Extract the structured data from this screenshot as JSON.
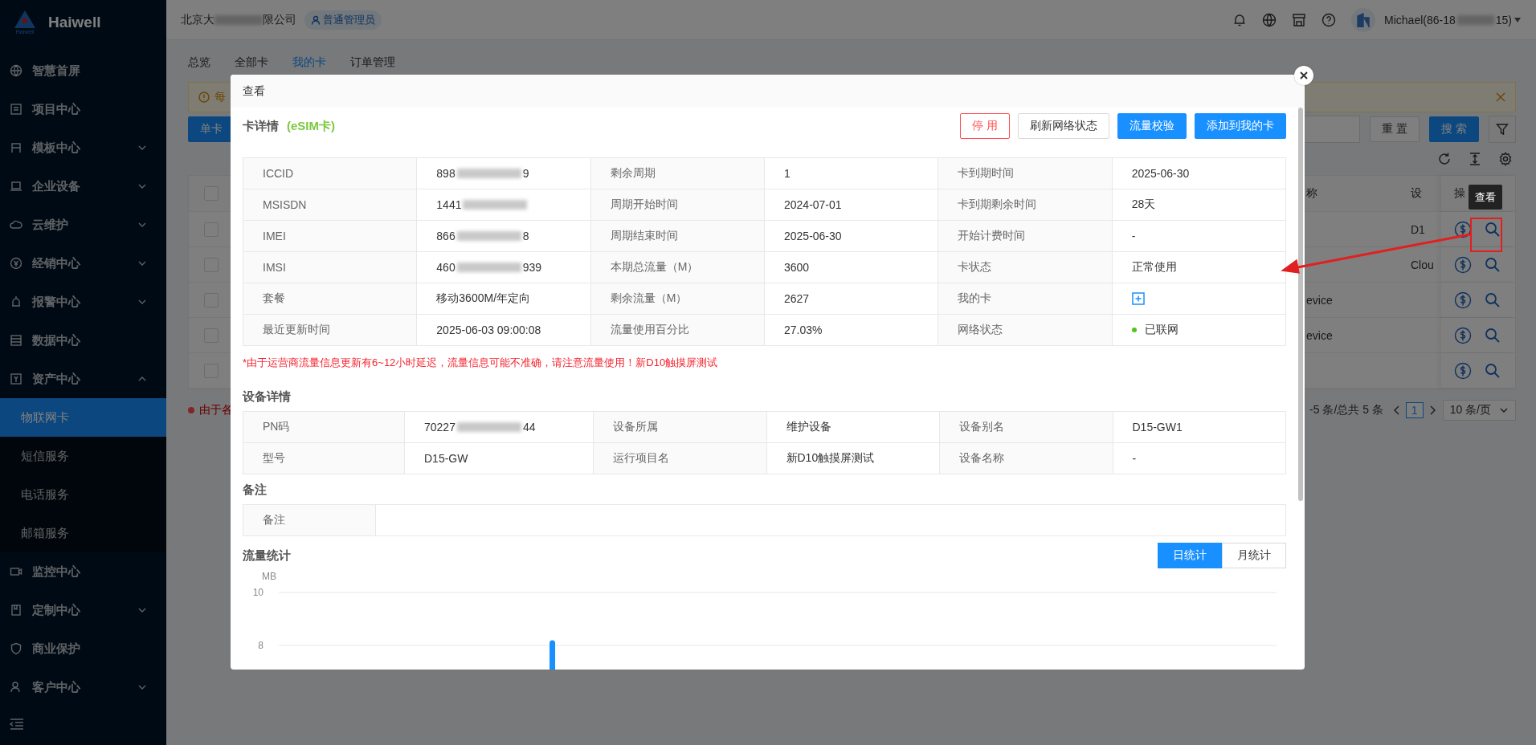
{
  "sidebar": {
    "logo": {
      "caption": "Haiwell",
      "name": "Haiwell"
    },
    "items": [
      {
        "label": "智慧首屏",
        "selected": false
      },
      {
        "label": "项目中心",
        "selected": false
      },
      {
        "label": "模板中心",
        "selected": false,
        "expanded": false
      },
      {
        "label": "企业设备",
        "selected": false,
        "expanded": false
      },
      {
        "label": "云维护",
        "selected": false,
        "expanded": false
      },
      {
        "label": "经销中心",
        "selected": false,
        "expanded": false
      },
      {
        "label": "报警中心",
        "selected": false,
        "expanded": false
      },
      {
        "label": "数据中心",
        "selected": false
      },
      {
        "label": "资产中心",
        "selected": false,
        "expanded": true,
        "children": [
          {
            "label": "物联网卡",
            "selected": true
          },
          {
            "label": "短信服务",
            "selected": false
          },
          {
            "label": "电话服务",
            "selected": false
          },
          {
            "label": "邮箱服务",
            "selected": false
          }
        ]
      },
      {
        "label": "监控中心",
        "selected": false
      },
      {
        "label": "定制中心",
        "selected": false,
        "expanded": false
      },
      {
        "label": "商业保护",
        "selected": false
      },
      {
        "label": "客户中心",
        "selected": false,
        "expanded": false
      }
    ]
  },
  "header": {
    "company_start": "北京大",
    "company_end": "限公司",
    "role_badge": "普通管理员",
    "user_start": "Michael(86-18",
    "user_end": "15)"
  },
  "tabs": [
    {
      "label": "总览",
      "selected": false
    },
    {
      "label": "全部卡",
      "selected": false
    },
    {
      "label": "我的卡",
      "selected": true
    },
    {
      "label": "订单管理",
      "selected": false
    }
  ],
  "alert": {
    "text": "每"
  },
  "toolbar": {
    "add_button": "单卡",
    "reset_button": "重 置",
    "search_button": "搜 索"
  },
  "table": {
    "columns": [
      "称",
      "设",
      "操"
    ],
    "header_checked": false,
    "rows": [
      {
        "checked": false,
        "device": "D1"
      },
      {
        "checked": false,
        "device": "Clou"
      },
      {
        "checked": false,
        "name": "evice"
      },
      {
        "checked": false,
        "name": "evice"
      },
      {
        "checked": false
      }
    ]
  },
  "footer_note": "由于各",
  "pagination": {
    "range": "-5 条/总共 5 条",
    "page": "1",
    "page_size": "10 条/页"
  },
  "tooltip": "查看",
  "modal": {
    "title": "查看",
    "card_section": {
      "title": "卡详情",
      "tag": "(eSIM卡)",
      "buttons": [
        {
          "label": "停 用",
          "kind": "danger"
        },
        {
          "label": "刷新网络状态",
          "kind": "default"
        },
        {
          "label": "流量校验",
          "kind": "primary"
        },
        {
          "label": "添加到我的卡",
          "kind": "primary"
        }
      ],
      "rows": [
        [
          {
            "kind": "label",
            "text": "ICCID"
          },
          {
            "kind": "masked",
            "start": "898",
            "end": "9"
          },
          {
            "kind": "label",
            "text": "剩余周期"
          },
          {
            "kind": "text",
            "text": "1"
          },
          {
            "kind": "label",
            "text": "卡到期时间"
          },
          {
            "kind": "text",
            "text": "2025-06-30"
          }
        ],
        [
          {
            "kind": "label",
            "text": "MSISDN"
          },
          {
            "kind": "masked",
            "start": "1441"
          },
          {
            "kind": "label",
            "text": "周期开始时间"
          },
          {
            "kind": "text",
            "text": "2024-07-01"
          },
          {
            "kind": "label",
            "text": "卡到期剩余时间"
          },
          {
            "kind": "text",
            "text": "28天"
          }
        ],
        [
          {
            "kind": "label",
            "text": "IMEI"
          },
          {
            "kind": "masked",
            "start": "866",
            "end": "8"
          },
          {
            "kind": "label",
            "text": "周期结束时间"
          },
          {
            "kind": "text",
            "text": "2025-06-30"
          },
          {
            "kind": "label",
            "text": "开始计费时间"
          },
          {
            "kind": "text",
            "text": "-"
          }
        ],
        [
          {
            "kind": "label",
            "text": "IMSI"
          },
          {
            "kind": "masked",
            "start": "460",
            "end": "939"
          },
          {
            "kind": "label",
            "text": "本期总流量（M）"
          },
          {
            "kind": "text",
            "text": "3600"
          },
          {
            "kind": "label",
            "text": "卡状态"
          },
          {
            "kind": "text",
            "text": "正常使用"
          }
        ],
        [
          {
            "kind": "label",
            "text": "套餐"
          },
          {
            "kind": "text",
            "text": "移动3600M/年定向"
          },
          {
            "kind": "label",
            "text": "剩余流量（M）"
          },
          {
            "kind": "text",
            "text": "2627"
          },
          {
            "kind": "label",
            "text": "我的卡"
          },
          {
            "kind": "add"
          }
        ],
        [
          {
            "kind": "label",
            "text": "最近更新时间"
          },
          {
            "kind": "text",
            "text": "2025-06-03 09:00:08"
          },
          {
            "kind": "label",
            "text": "流量使用百分比"
          },
          {
            "kind": "text",
            "text": "27.03%"
          },
          {
            "kind": "label",
            "text": "网络状态"
          },
          {
            "kind": "status",
            "text": "已联网",
            "color": "#52c41a"
          }
        ]
      ]
    },
    "notice": "*由于运营商流量信息更新有6~12小时延迟，流量信息可能不准确，请注意流量使用！新D10触摸屏测试",
    "device_section": {
      "title": "设备详情",
      "rows": [
        [
          {
            "kind": "label",
            "text": "PN码"
          },
          {
            "kind": "masked",
            "start": "70227",
            "end": "44"
          },
          {
            "kind": "label",
            "text": "设备所属"
          },
          {
            "kind": "text",
            "text": "维护设备"
          },
          {
            "kind": "label",
            "text": "设备别名"
          },
          {
            "kind": "text",
            "text": "D15-GW1"
          }
        ],
        [
          {
            "kind": "label",
            "text": "型号"
          },
          {
            "kind": "text",
            "text": "D15-GW"
          },
          {
            "kind": "label",
            "text": "运行项目名"
          },
          {
            "kind": "text",
            "text": "新D10触摸屏测试"
          },
          {
            "kind": "label",
            "text": "设备名称"
          },
          {
            "kind": "text",
            "text": "-"
          }
        ]
      ]
    },
    "remark_section": {
      "title": "备注",
      "rows": [
        [
          {
            "kind": "label",
            "text": "备注"
          },
          {
            "kind": "empty"
          }
        ]
      ]
    },
    "traffic_section": {
      "title": "流量统计",
      "toggle": [
        {
          "label": "日统计",
          "selected": true
        },
        {
          "label": "月统计",
          "selected": false
        }
      ],
      "chart_data": {
        "type": "bar",
        "ylabel": "MB",
        "ylim": [
          0,
          10
        ],
        "yticks": [
          8,
          10
        ],
        "values": [
          null,
          null,
          null,
          null,
          null,
          null,
          null,
          null,
          8.2,
          null,
          null,
          null,
          null,
          null,
          null,
          null,
          null,
          null,
          null,
          null,
          null,
          null,
          null,
          null,
          null,
          null,
          null,
          null,
          null,
          null,
          null
        ]
      }
    }
  }
}
